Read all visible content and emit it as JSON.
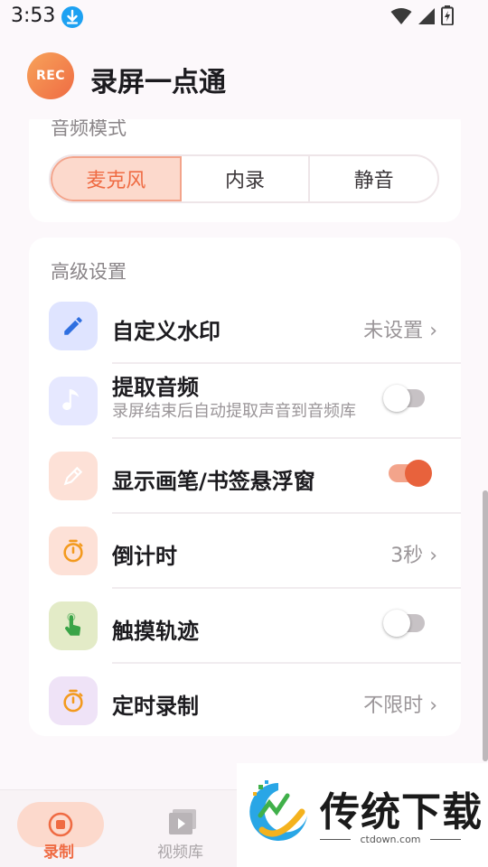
{
  "status_bar": {
    "time": "3:53"
  },
  "header": {
    "logo_text": "REC",
    "title": "录屏一点通"
  },
  "audio_mode": {
    "title": "音频模式",
    "options": [
      "麦克风",
      "内录",
      "静音"
    ],
    "selected": "麦克风"
  },
  "advanced": {
    "title": "高级设置",
    "rows": [
      {
        "label": "自定义水印",
        "value": "未设置",
        "icon": "pencil-icon",
        "icon_bg": "#dfe4ff",
        "icon_color": "#2f6fe0"
      },
      {
        "label": "提取音频",
        "sub": "录屏结束后自动提取声音到音频库",
        "switch": "off",
        "icon": "music-note-icon",
        "icon_bg": "#e6e8ff",
        "icon_color": "#ffffff"
      },
      {
        "label": "显示画笔/书签悬浮窗",
        "switch": "on",
        "icon": "pen-icon",
        "icon_bg": "#fde1d7",
        "icon_color": "#ffffff"
      },
      {
        "label": "倒计时",
        "value": "3秒",
        "icon": "stopwatch-icon",
        "icon_bg": "#fde1d7",
        "icon_color": "#f39a1e"
      },
      {
        "label": "触摸轨迹",
        "switch": "off",
        "icon": "tap-hand-icon",
        "icon_bg": "#e3ebc7",
        "icon_color": "#3aa447"
      },
      {
        "label": "定时录制",
        "value": "不限时",
        "icon": "stopwatch-icon",
        "icon_bg": "#efe3f7",
        "icon_color": "#f39a1e"
      }
    ],
    "chevron": "›"
  },
  "bottom_nav": {
    "record_label": "录制",
    "library_label": "视频库"
  },
  "watermark": {
    "text": "传统下载",
    "url": "ctdown.com"
  },
  "colors": {
    "accent": "#ef6b43",
    "accent_light": "#fcd9cc"
  }
}
